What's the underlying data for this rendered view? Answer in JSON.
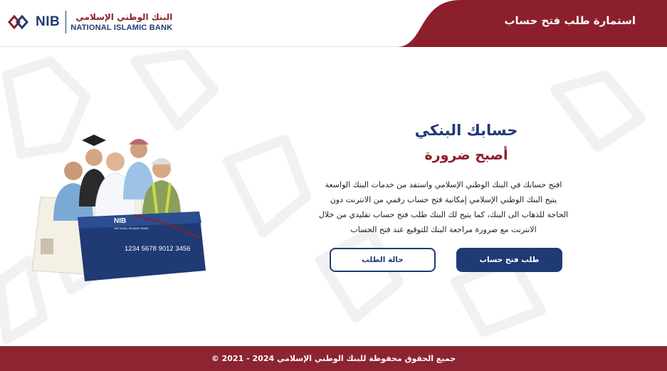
{
  "header": {
    "title": "استمارة طلب فتح حساب",
    "logo": {
      "short": "NIB",
      "arabic": "البنك الوطني الإسلامي",
      "english": "NATIONAL ISLAMIC BANK"
    }
  },
  "hero": {
    "title": "حسابك البنكي",
    "subtitle": "أصبح ضرورة",
    "body_lines": [
      "افتح حسابك في البنك الوطني الإسلامي واستفد من خدمات البنك الواسعة",
      "يتيح البنك الوطني الإسلامي إمكانية فتح حساب رقمي من الانترنت دون",
      "الحاجة للذهاب الى البنك، كما يتيح لك البنك طلب فتح حساب تقليدي من خلال",
      "الانترنت مع ضرورة مراجعة البنك للتوقيع عند فتح الحساب"
    ],
    "primary_button": "طلب فتح حساب",
    "secondary_button": "حالة الطلب"
  },
  "illustration": {
    "card_number": "1234  5678  9012  3456",
    "card_brand": "NIB",
    "card_brand_sub": "NATIONAL ISLAMIC BANK"
  },
  "footer": {
    "copyright": "جميع الحقوق محفوظة للبنك الوطني الإسلامي 2024 - 2021 ©"
  },
  "colors": {
    "brand_blue": "#1f3a74",
    "brand_maroon": "#8c1f2c",
    "footer_bg": "#8c2432"
  }
}
